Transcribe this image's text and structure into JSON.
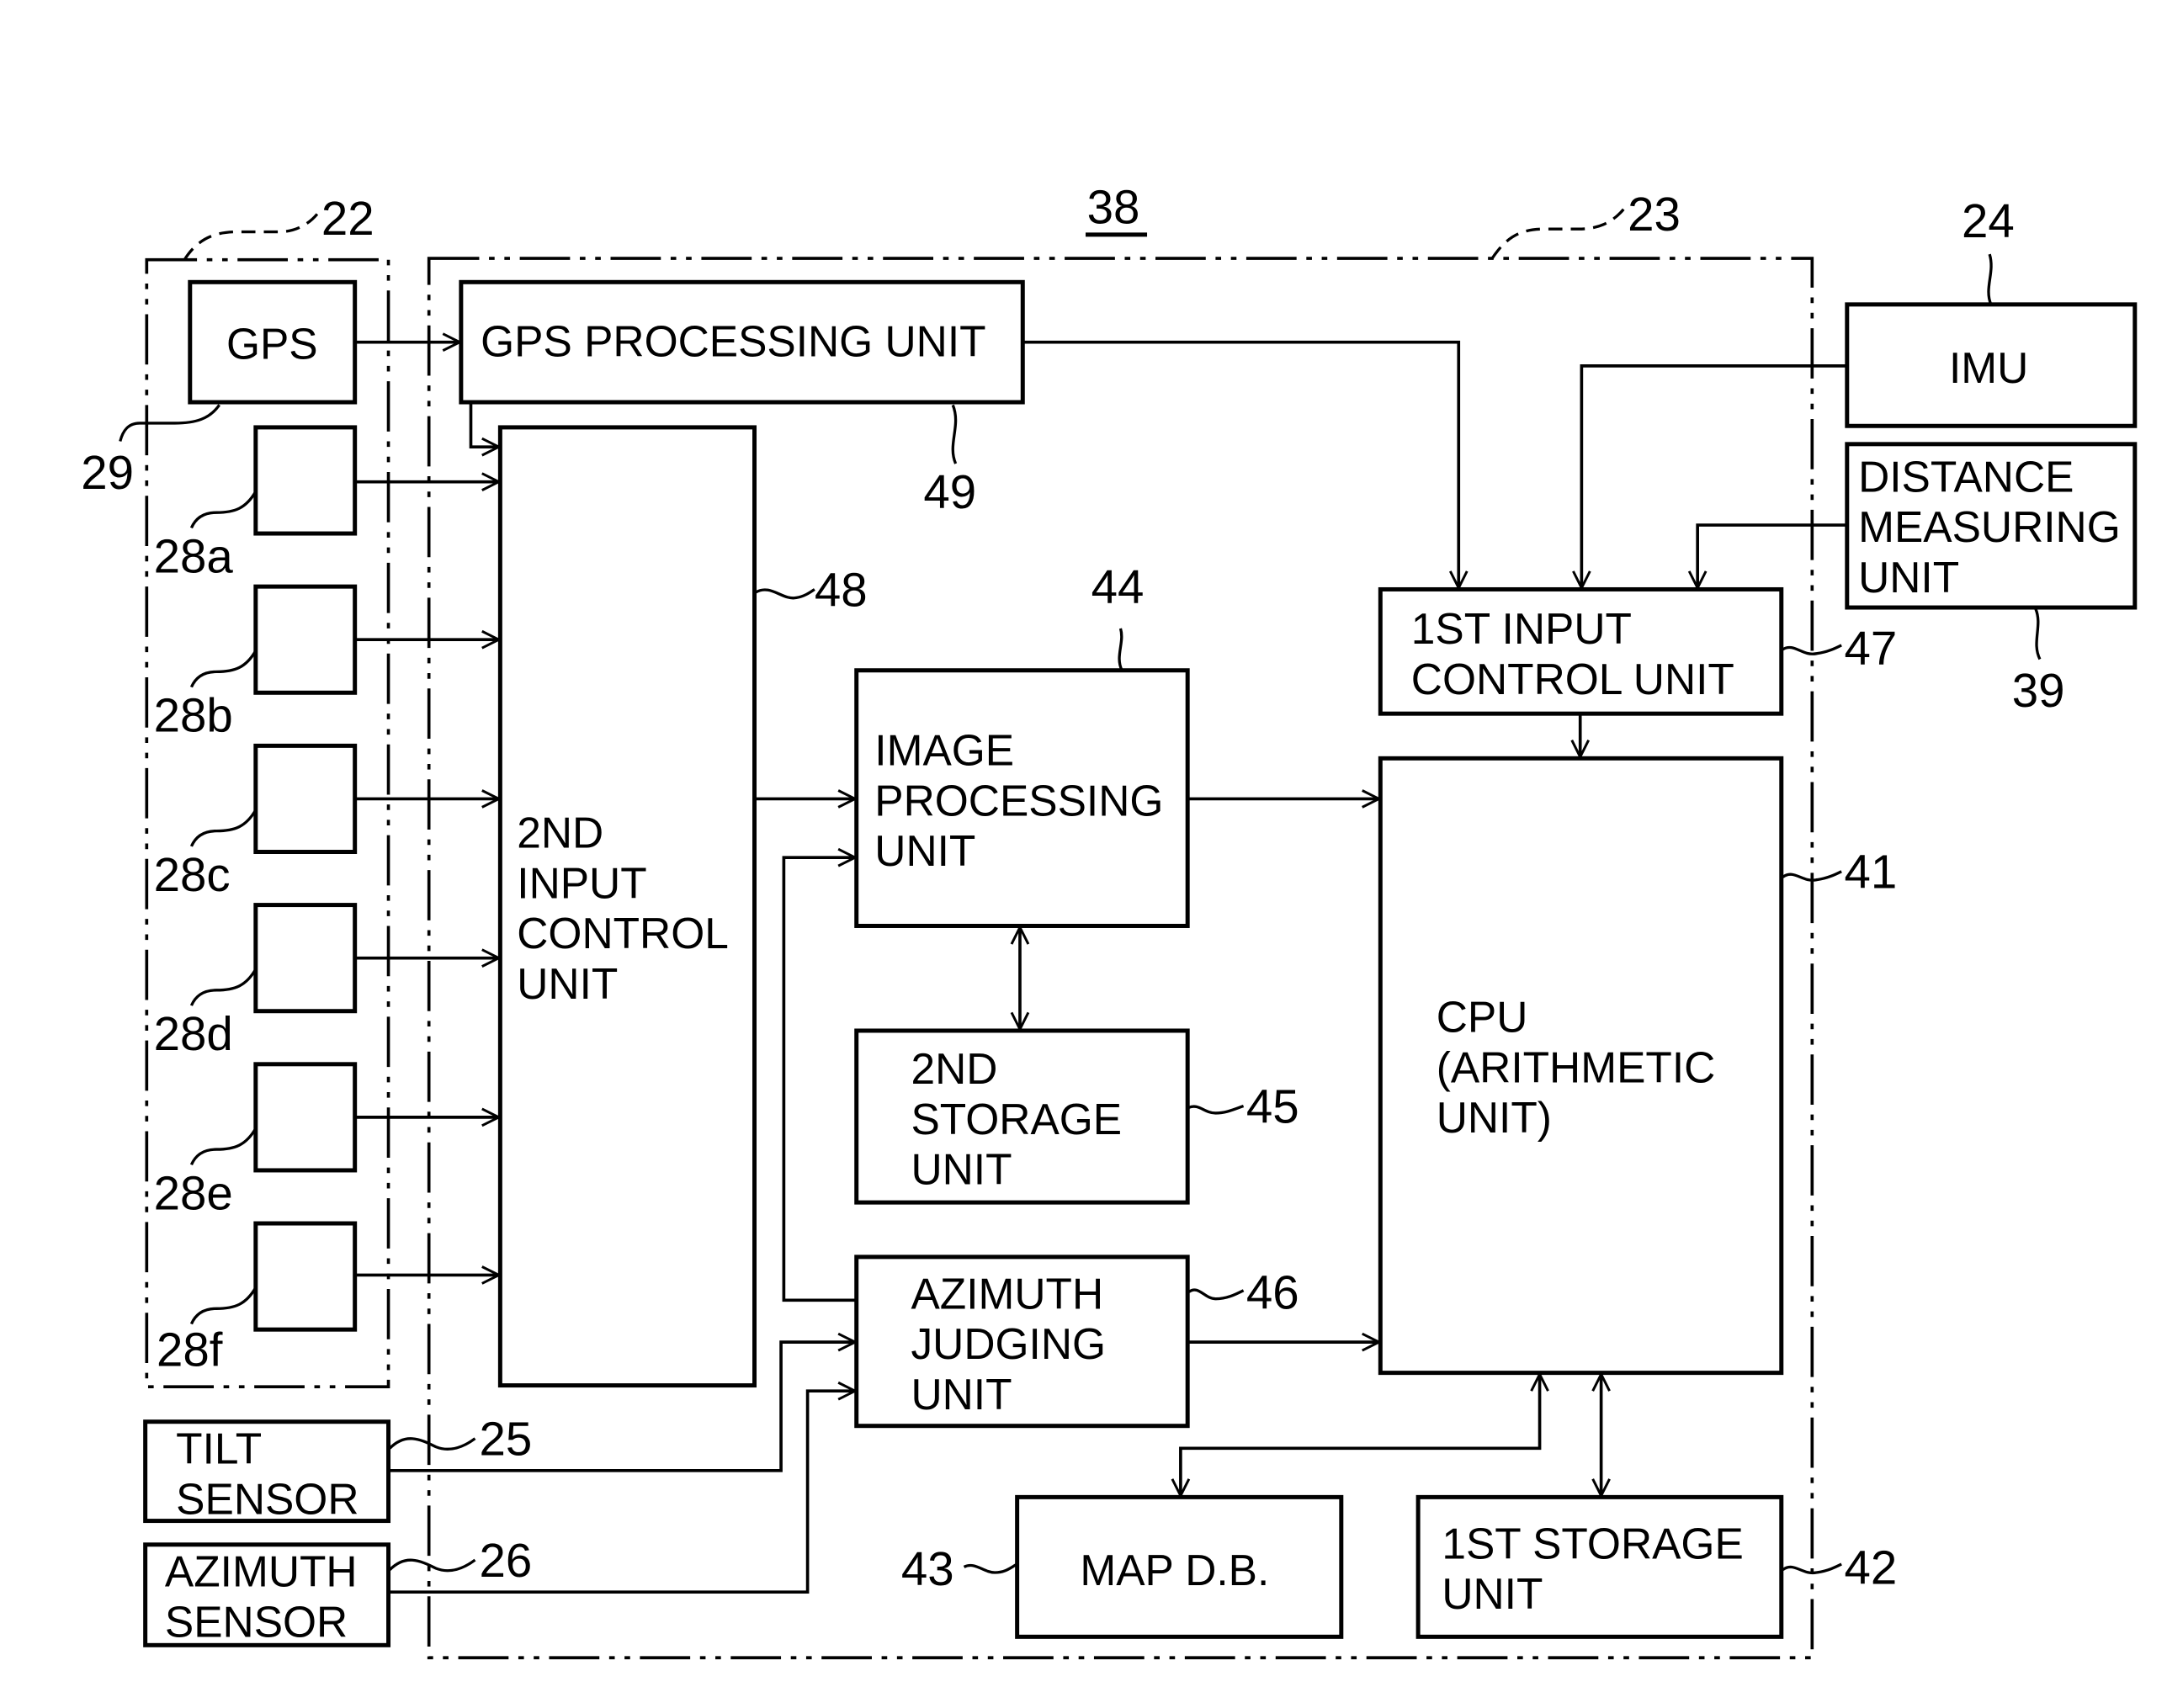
{
  "figure": {
    "ref": "38",
    "groups": [
      {
        "id": "sensor-group",
        "ref": "22"
      },
      {
        "id": "control-device",
        "ref": "23"
      }
    ],
    "blocks": [
      {
        "id": "gps",
        "ref": "29",
        "lines": [
          "GPS"
        ]
      },
      {
        "id": "camera-28a",
        "ref": "28a",
        "lines": []
      },
      {
        "id": "camera-28b",
        "ref": "28b",
        "lines": []
      },
      {
        "id": "camera-28c",
        "ref": "28c",
        "lines": []
      },
      {
        "id": "camera-28d",
        "ref": "28d",
        "lines": []
      },
      {
        "id": "camera-28e",
        "ref": "28e",
        "lines": []
      },
      {
        "id": "camera-28f",
        "ref": "28f",
        "lines": []
      },
      {
        "id": "gps-processing-unit",
        "ref": "49",
        "lines": [
          "GPS PROCESSING UNIT"
        ]
      },
      {
        "id": "second-input-control-unit",
        "ref": "48",
        "lines": [
          "2ND",
          "INPUT",
          "CONTROL",
          "UNIT"
        ]
      },
      {
        "id": "image-processing-unit",
        "ref": "44",
        "lines": [
          "IMAGE",
          "PROCESSING",
          "UNIT"
        ]
      },
      {
        "id": "second-storage-unit",
        "ref": "45",
        "lines": [
          "2ND",
          "STORAGE",
          "UNIT"
        ]
      },
      {
        "id": "azimuth-judging-unit",
        "ref": "46",
        "lines": [
          "AZIMUTH",
          "JUDGING",
          "UNIT"
        ]
      },
      {
        "id": "first-input-control-unit",
        "ref": "47",
        "lines": [
          "1ST INPUT",
          "CONTROL UNIT"
        ]
      },
      {
        "id": "cpu",
        "ref": "41",
        "lines": [
          "CPU",
          "(ARITHMETIC",
          "UNIT)"
        ]
      },
      {
        "id": "map-db",
        "ref": "43",
        "lines": [
          "MAP D.B."
        ]
      },
      {
        "id": "first-storage-unit",
        "ref": "42",
        "lines": [
          "1ST STORAGE",
          "UNIT"
        ]
      },
      {
        "id": "imu",
        "ref": "24",
        "lines": [
          "IMU"
        ]
      },
      {
        "id": "distance-measuring-unit",
        "ref": "39",
        "lines": [
          "DISTANCE",
          "MEASURING",
          "UNIT"
        ]
      },
      {
        "id": "tilt-sensor",
        "ref": "25",
        "lines": [
          "TILT",
          "SENSOR"
        ]
      },
      {
        "id": "azimuth-sensor",
        "ref": "26",
        "lines": [
          "AZIMUTH",
          "SENSOR"
        ]
      }
    ],
    "connections": [
      {
        "from": "gps",
        "to": "gps-processing-unit"
      },
      {
        "from": "gps-processing-unit",
        "to": "second-input-control-unit"
      },
      {
        "from": "gps-processing-unit",
        "to": "first-input-control-unit"
      },
      {
        "from": "camera-28a",
        "to": "second-input-control-unit"
      },
      {
        "from": "camera-28b",
        "to": "second-input-control-unit"
      },
      {
        "from": "camera-28c",
        "to": "second-input-control-unit"
      },
      {
        "from": "camera-28d",
        "to": "second-input-control-unit"
      },
      {
        "from": "camera-28e",
        "to": "second-input-control-unit"
      },
      {
        "from": "camera-28f",
        "to": "second-input-control-unit"
      },
      {
        "from": "second-input-control-unit",
        "to": "image-processing-unit"
      },
      {
        "from": "azimuth-judging-unit",
        "to": "image-processing-unit"
      },
      {
        "from": "image-processing-unit",
        "to": "second-storage-unit",
        "bidirectional": true
      },
      {
        "from": "image-processing-unit",
        "to": "cpu"
      },
      {
        "from": "tilt-sensor",
        "to": "azimuth-judging-unit"
      },
      {
        "from": "azimuth-sensor",
        "to": "azimuth-judging-unit"
      },
      {
        "from": "azimuth-judging-unit",
        "to": "cpu"
      },
      {
        "from": "imu",
        "to": "first-input-control-unit"
      },
      {
        "from": "distance-measuring-unit",
        "to": "first-input-control-unit"
      },
      {
        "from": "first-input-control-unit",
        "to": "cpu"
      },
      {
        "from": "cpu",
        "to": "map-db",
        "bidirectional": true
      },
      {
        "from": "cpu",
        "to": "first-storage-unit",
        "bidirectional": true
      }
    ]
  }
}
